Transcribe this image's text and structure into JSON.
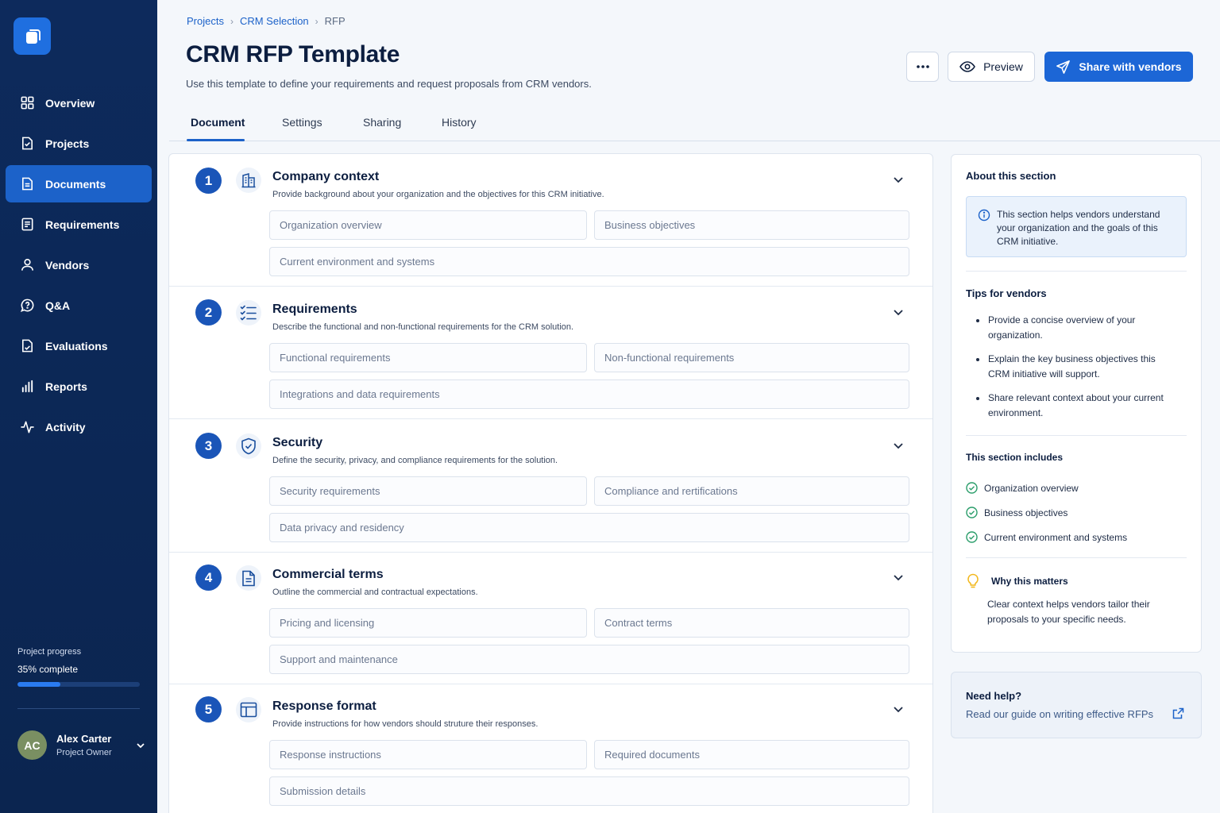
{
  "sidebar": {
    "items": [
      {
        "label": "Overview"
      },
      {
        "label": "Projects"
      },
      {
        "label": "Documents"
      },
      {
        "label": "Requirements"
      },
      {
        "label": "Vendors"
      },
      {
        "label": "Q&A"
      },
      {
        "label": "Evaluations"
      },
      {
        "label": "Reports"
      },
      {
        "label": "Activity"
      }
    ],
    "active_index": 2,
    "progress": {
      "label": "Project progress",
      "value_text": "35% complete",
      "percent": 35
    },
    "user": {
      "initials": "AC",
      "name": "Alex Carter",
      "role": "Project Owner",
      "avatar_color": "#7a8f62"
    }
  },
  "breadcrumb": {
    "items": [
      "Projects",
      "CRM Selection",
      "RFP"
    ]
  },
  "header": {
    "title": "CRM RFP Template",
    "subtitle": "Use this template to define your requirements and request proposals from CRM vendors.",
    "preview_label": "Preview",
    "share_label": "Share with vendors"
  },
  "tabs": [
    {
      "label": "Document"
    },
    {
      "label": "Settings"
    },
    {
      "label": "Sharing"
    },
    {
      "label": "History"
    }
  ],
  "sections": [
    {
      "number": "1",
      "title": "Company context",
      "icon": "building-icon",
      "description": "Provide background about your organization and the objectives for this CRM initiative.",
      "fields": [
        "Organization overview",
        "Business objectives",
        "Current environment and systems"
      ]
    },
    {
      "number": "2",
      "title": "Requirements",
      "icon": "checklist-icon",
      "description": "Describe the functional and non-functional requirements for the CRM solution.",
      "fields": [
        "Functional requirements",
        "Non-functional requirements",
        "Integrations and data requirements"
      ]
    },
    {
      "number": "3",
      "title": "Security",
      "icon": "shield-check-icon",
      "description": "Define the security, privacy, and compliance requirements for the solution.",
      "fields": [
        "Security requirements",
        "Compliance and rertifications",
        "Data privacy and residency"
      ]
    },
    {
      "number": "4",
      "title": "Commercial terms",
      "icon": "document-icon",
      "description": "Outline the commercial and contractual expectations.",
      "fields": [
        "Pricing and licensing",
        "Contract terms",
        "Support and maintenance"
      ]
    },
    {
      "number": "5",
      "title": "Response format",
      "icon": "layout-icon",
      "description": "Provide instructions for how vendors should struture their responses.",
      "fields": [
        "Response instructions",
        "Required documents",
        "Submission details"
      ]
    }
  ],
  "panel": {
    "about_title": "About this section",
    "about_text": "This section helps vendors understand your organization and the goals of this CRM initiative.",
    "tips_title": "Tips for vendors",
    "tips": [
      "Provide a concise overview of your organization.",
      "Explain the key business objectives this CRM initiative will support.",
      "Share relevant context about your current environment."
    ],
    "includes_title": "This section includes",
    "includes": [
      "Organization overview",
      "Business objectives",
      "Current environment and systems"
    ],
    "why_title": "Why this matters",
    "why_text": "Clear context helps vendors tailor their proposals to your specific needs."
  },
  "help": {
    "title": "Need help?",
    "link": "Read our guide on writing effective RFPs"
  },
  "colors": {
    "sidebar_bg": "#0d2a5c",
    "accent": "#1c66d6",
    "step_badge": "#1a55b8",
    "check_green": "#2a9d6a",
    "bulb_yellow": "#f2b71b"
  }
}
